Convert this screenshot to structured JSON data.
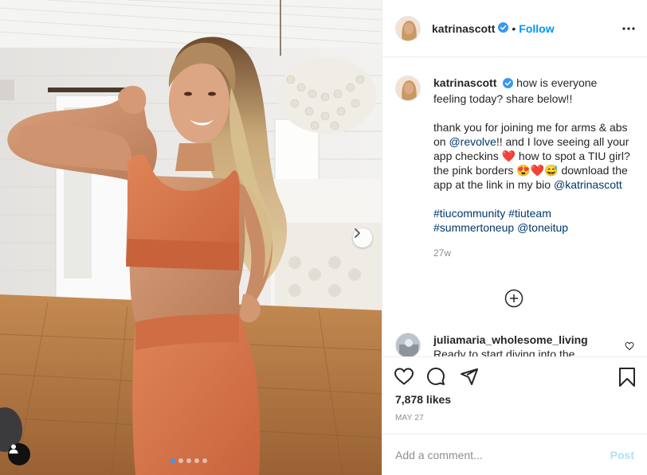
{
  "post": {
    "username": "katrinascott",
    "verified": true,
    "follow_label": "Follow",
    "bullet": "•",
    "image": {
      "alt_subject": "woman flexing arm in orange sports bra and leggings in a white bedroom",
      "carousel_dots": 5,
      "active_dot": 0
    }
  },
  "caption": {
    "username": "katrinascott",
    "line1": "how is everyone feeling today? share below!!",
    "para2_a": "thank you for joining me for arms & abs on ",
    "mention_revolve": "@revolve",
    "para2_b": "!! and I love seeing all your app checkins ",
    "heart_emoji": "❤️",
    "para2_c": " how to spot a TIU girl? the pink borders ",
    "emojis2": "😍❤️😅",
    "para2_d": " download the app at the link in my bio ",
    "mention_katrina": "@katrinascott",
    "tag1": "#tiucommunity",
    "tag2": "#tiuteam",
    "tag3": "#summertoneup",
    "mention_toneitup": "@toneitup",
    "time": "27w"
  },
  "comment": {
    "username": "juliamaria_wholesome_living",
    "text": "Ready to start diving into the"
  },
  "stats": {
    "likes": "7,878 likes",
    "date": "MAY 27"
  },
  "add_comment": {
    "placeholder": "Add a comment...",
    "post_label": "Post"
  },
  "icons": {
    "more": "more-horizontal-icon",
    "like": "heart-icon",
    "comment": "comment-icon",
    "share": "share-icon",
    "save": "bookmark-icon",
    "load_more": "plus-circle-icon",
    "user_tags": "user-tag-icon",
    "next": "chevron-right-icon"
  },
  "colors": {
    "accent": "#0095f6",
    "link": "#00376b",
    "muted": "#8e8e8e",
    "post_disabled": "#b2dffc",
    "outfit": "#d9774e"
  }
}
